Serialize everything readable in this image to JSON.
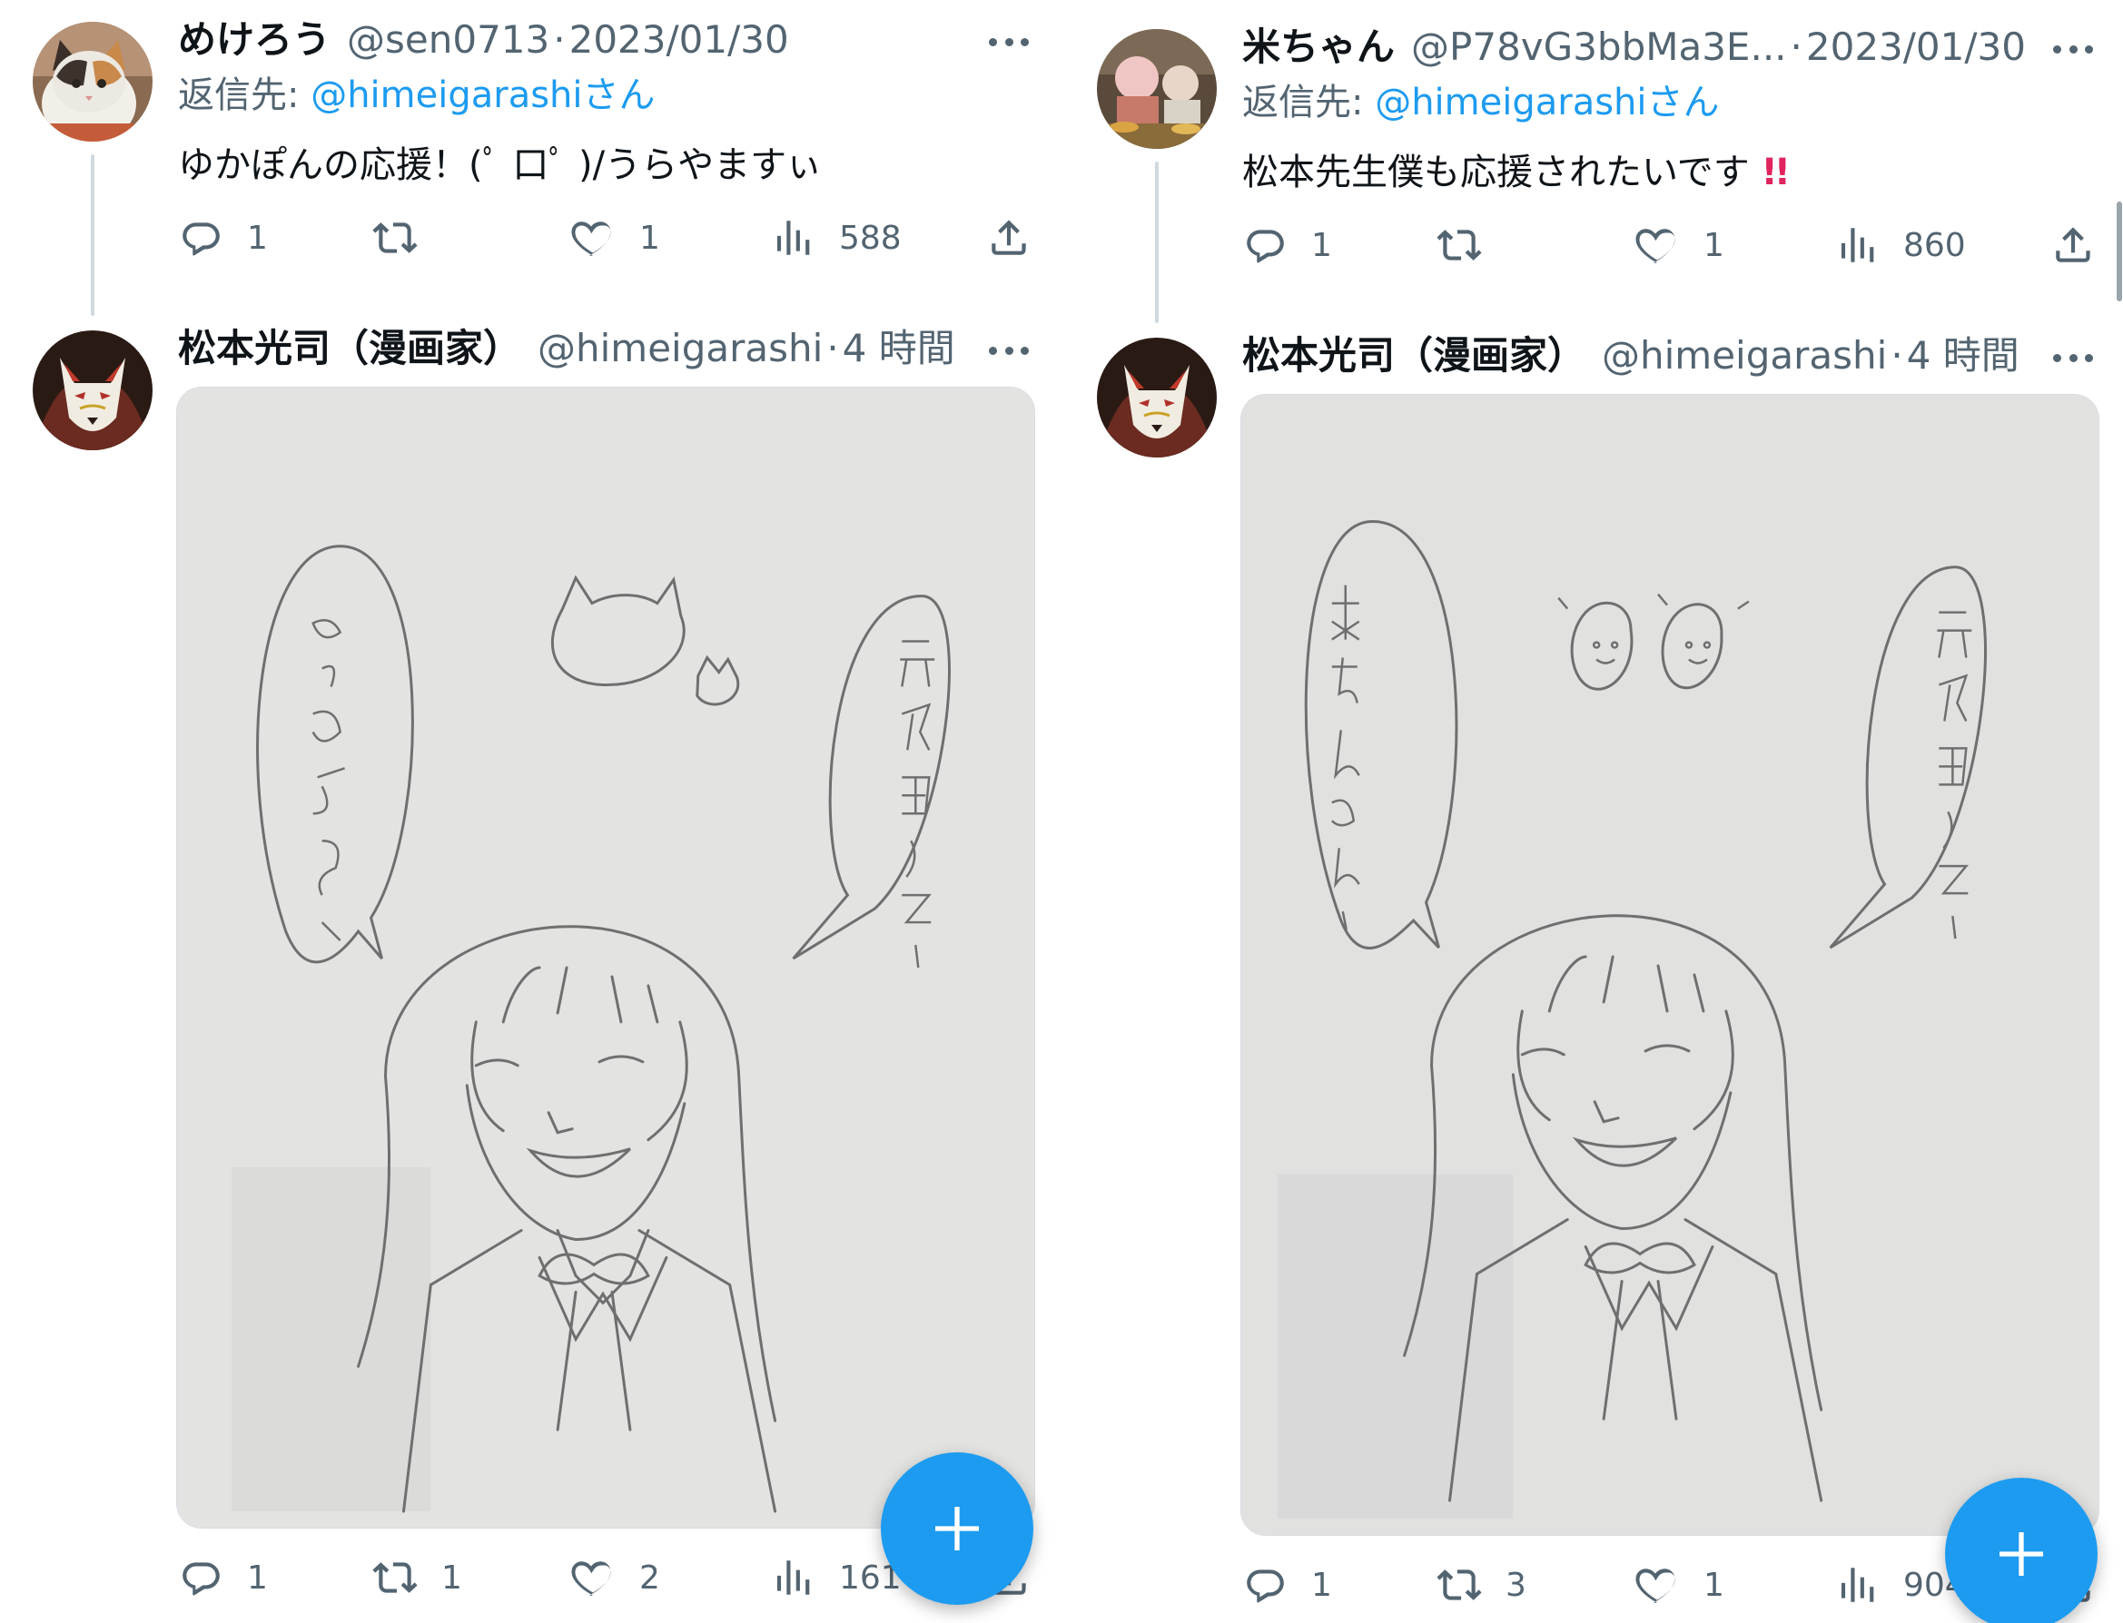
{
  "colors": {
    "accent": "#1d9bf0",
    "text": "#0f1419",
    "muted": "#536471",
    "line": "#cfd9de",
    "exclaim": "#e0245e"
  },
  "left": {
    "reply": {
      "name": "めけろう",
      "handle": "@sen0713",
      "dot": "·",
      "date": "2023/01/30",
      "reply_prefix": "返信先: ",
      "reply_handle": "@himeigarashi",
      "reply_suffix": "さん",
      "text": "ゆかぽんの応援！(ﾟ 口ﾟ )/うらやますぃ",
      "stats": {
        "replies": "1",
        "likes": "1",
        "views": "588"
      }
    },
    "main": {
      "name": "松本光司（漫画家）",
      "handle": "@himeigarashi",
      "dot": "·",
      "time": "4 時間",
      "bubble_left": "めけろうさん!",
      "bubble_right": "元気出して!",
      "stats": {
        "replies": "1",
        "retweets": "1",
        "likes": "2",
        "views": "161"
      }
    }
  },
  "right": {
    "reply": {
      "name": "米ちゃん",
      "handle": "@P78vG3bbMa3E...",
      "dot": "·",
      "date": "2023/01/30",
      "reply_prefix": "返信先: ",
      "reply_handle": "@himeigarashi",
      "reply_suffix": "さん",
      "text": "松本先生僕も応援されたいです",
      "emoji": "!!",
      "stats": {
        "replies": "1",
        "likes": "1",
        "views": "860"
      }
    },
    "main": {
      "name": "松本光司（漫画家）",
      "handle": "@himeigarashi",
      "dot": "·",
      "time": "4 時間",
      "bubble_left": "米ちゃんさん!",
      "bubble_right": "元気出して!",
      "stats": {
        "replies": "1",
        "retweets": "3",
        "likes": "1",
        "views": "904"
      }
    }
  },
  "icons": [
    "reply-icon",
    "retweet-icon",
    "like-icon",
    "views-icon",
    "share-icon",
    "more-icon",
    "compose-plus-icon"
  ]
}
